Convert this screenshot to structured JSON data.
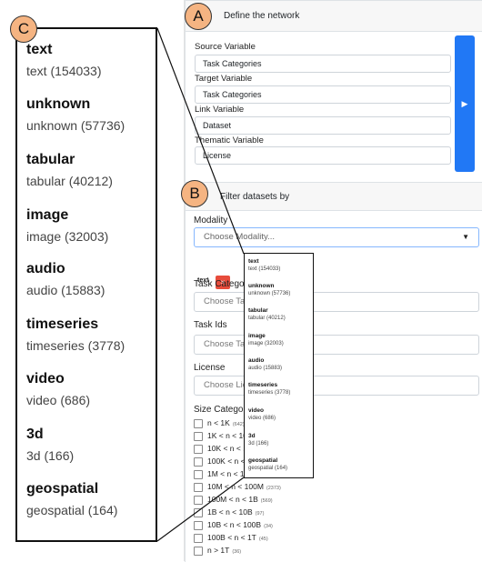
{
  "callouts": {
    "a": "A",
    "b": "B",
    "c": "C"
  },
  "network": {
    "header": "Define the network",
    "source_label": "Source Variable",
    "source_value": "Task Categories",
    "target_label": "Target Variable",
    "target_value": "Task Categories",
    "link_label": "Link Variable",
    "link_value": "Dataset",
    "thematic_label": "Thematic Variable",
    "thematic_value": "License",
    "go_icon": "play-icon"
  },
  "filter": {
    "header": "Filter datasets by",
    "modality_label": "Modality",
    "modality_placeholder": "Choose Modality...",
    "selected_chip": "text",
    "chip_remove": "×",
    "task_categories_label": "Task Categories",
    "task_categories_placeholder": "Choose Task Categories...",
    "task_ids_label": "Task Ids",
    "task_ids_placeholder": "Choose Task Ids...",
    "license_label": "License",
    "license_placeholder": "Choose License...",
    "size_label": "Size Categories",
    "sizes": [
      {
        "label": "n < 1K",
        "count": "(642)"
      },
      {
        "label": "1K < n < 10K",
        "count": ""
      },
      {
        "label": "10K < n < 100K",
        "count": ""
      },
      {
        "label": "100K < n < 1M",
        "count": ""
      },
      {
        "label": "1M < n < 10M",
        "count": ""
      },
      {
        "label": "10M < n < 100M",
        "count": "(2373)"
      },
      {
        "label": "100M < n < 1B",
        "count": "(569)"
      },
      {
        "label": "1B < n < 10B",
        "count": "(97)"
      },
      {
        "label": "10B < n < 100B",
        "count": "(34)"
      },
      {
        "label": "100B < n < 1T",
        "count": "(45)"
      },
      {
        "label": "n > 1T",
        "count": "(36)"
      }
    ]
  },
  "modality_options": [
    {
      "name": "text",
      "sub": "text (154033)"
    },
    {
      "name": "unknown",
      "sub": "unknown (57736)"
    },
    {
      "name": "tabular",
      "sub": "tabular (40212)"
    },
    {
      "name": "image",
      "sub": "image (32003)"
    },
    {
      "name": "audio",
      "sub": "audio (15883)"
    },
    {
      "name": "timeseries",
      "sub": "timeseries (3778)"
    },
    {
      "name": "video",
      "sub": "video (686)"
    },
    {
      "name": "3d",
      "sub": "3d (166)"
    },
    {
      "name": "geospatial",
      "sub": "geospatial (164)"
    }
  ]
}
